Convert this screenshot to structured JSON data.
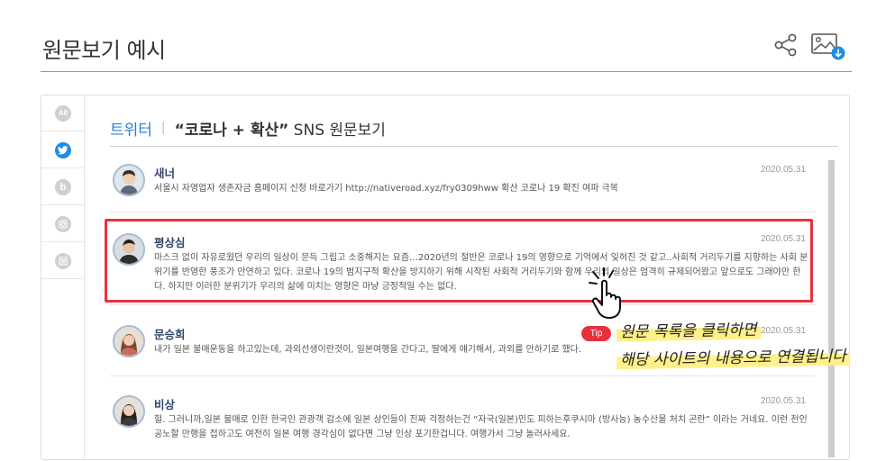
{
  "page": {
    "title": "원문보기 예시"
  },
  "header_icons": {
    "share": "share-icon",
    "download": "image-download-icon"
  },
  "rail": [
    {
      "label": "All",
      "icon": "all-icon",
      "active": false
    },
    {
      "label": "",
      "icon": "twitter-icon",
      "active": true
    },
    {
      "label": "b",
      "icon": "blog-icon",
      "active": false
    },
    {
      "label": "",
      "icon": "instagram-icon",
      "active": false
    },
    {
      "label": "",
      "icon": "news-icon",
      "active": false
    }
  ],
  "tabbar": {
    "source": "트위터",
    "separator": "|",
    "query": "“코로나 + 확산”",
    "suffix": " SNS 원문보기"
  },
  "posts": [
    {
      "name": "새너",
      "date": "2020.05.31",
      "text": "서울시 자영업자 생존자금 홈페이지 신청 바로가기 http://nativeroad.xyz/fry0309hww 확산 코로나 19 확진 여파 극복"
    },
    {
      "name": "평상심",
      "date": "2020.05.31",
      "text": "마스크 없이 자유로웠던 우리의 일상이 문득 그립고 소중해지는 요즘…2020년의 절반은 코로나 19의 영향으로 기억에서 잊혀진 것 같고..사회적 거리두기를 지향하는 사회 분위기를 반영한 풍조가 만연하고 있다. 코로나 19의 범지구적 확산을 방지하기 위해 시작된 사회적 거리두기와 함께 우리의 일상은 엄격히 규제되어왔고 앞으로도 그래야만 한다. 하지만 이러한 분위기가 우리의 삶에 미치는 영향은 마냥 긍정적일 수는 없다."
    },
    {
      "name": "문승희",
      "date": "2020.05.31",
      "text": "내가 일본 불매운동을 하고있는데, 과외선생이란것이, 일본여행을 간다고, 딸에게 얘기해서, 과외를 안하기로 했다."
    },
    {
      "name": "비상",
      "date": "2020.05.31",
      "text": "헐. 그러니까,일본 불매로 인한 한국인 관광객 감소에 일본 상인들이 진짜 걱정하는건 “자국(일본)민도 피하는후쿠시마 (방사능) 농수산물 처치 곤란” 이라는 거네요. 이런 천인공노할 만행을 접하고도 여전히 일본 여행 경각심이 없다면 그냥 인상 포기한겁니다. 여행가서 그냥 놀러사세요."
    }
  ],
  "tip": {
    "badge": "Tip",
    "line1": "원문 목록을 클릭하면",
    "line2": "해당 사이트의 내용으로 연결됩니다"
  },
  "colors": {
    "accent": "#1f8ce6",
    "highlight": "#e8303d",
    "marker": "#fff08a",
    "name": "#33466b"
  }
}
